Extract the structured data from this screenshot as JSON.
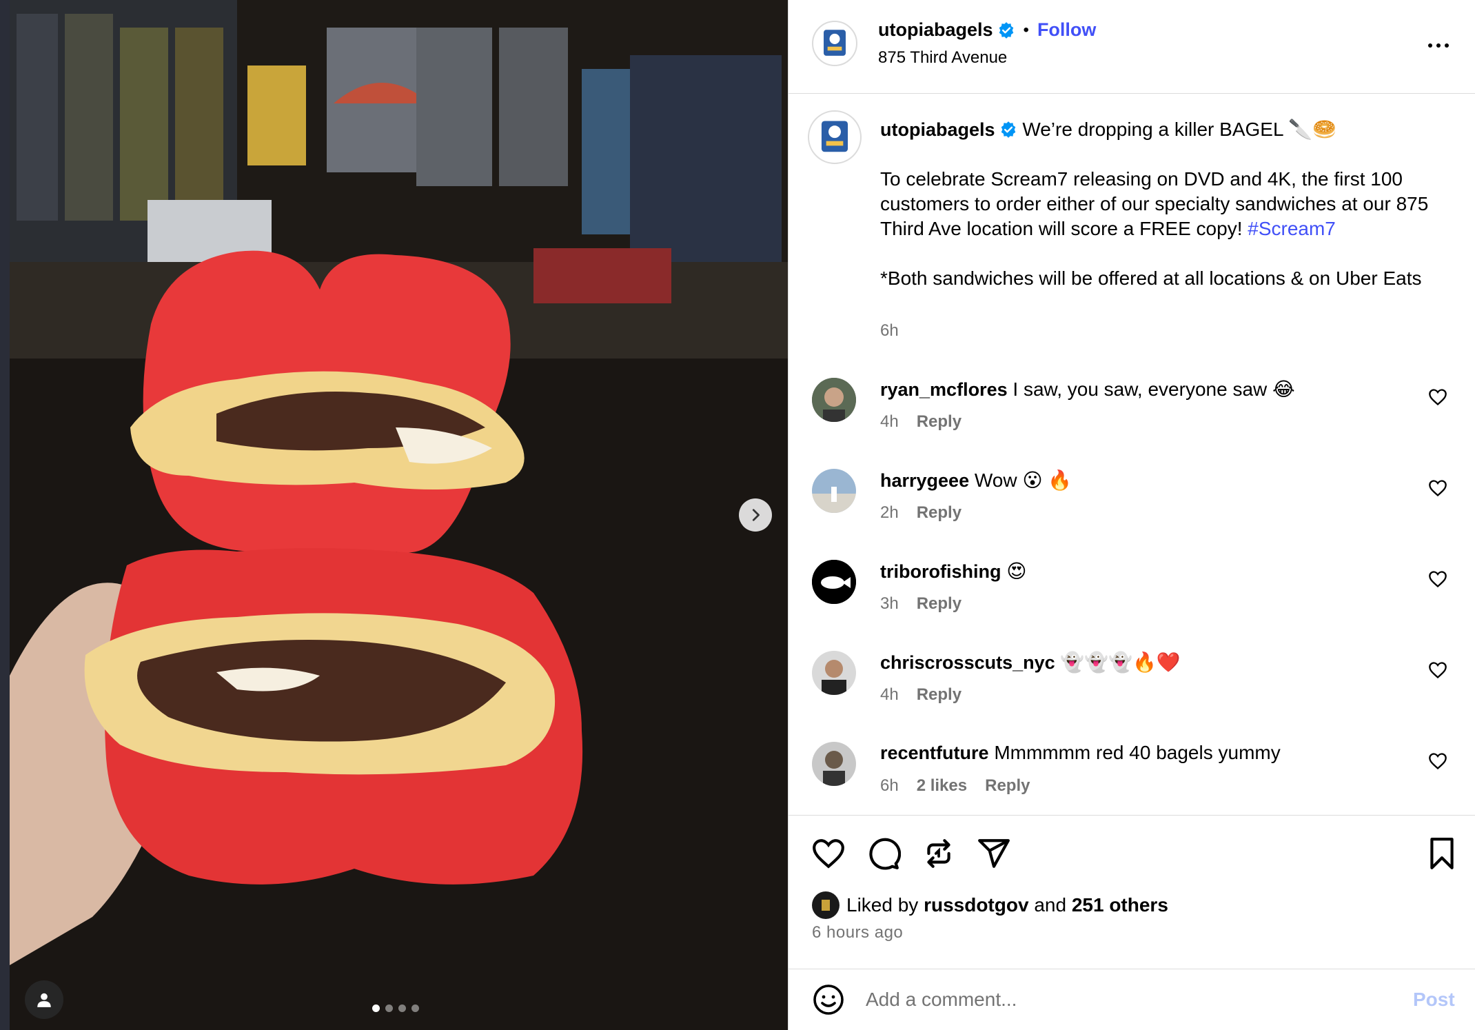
{
  "post": {
    "author": "utopiabagels",
    "follow_label": "Follow",
    "separator": "•",
    "location": "875 Third Avenue",
    "caption_line1": "We’re dropping a killer BAGEL 🔪🥯",
    "caption_p2_pre": "To celebrate Scream7 releasing on DVD and 4K, the first 100 customers to order either of our specialty sandwiches at our 875 Third Ave location will score a FREE copy! ",
    "caption_hashtag": "#Scream7",
    "caption_p3": "*Both sandwiches will be offered at all locations & on Uber Eats",
    "caption_time": "6h"
  },
  "comments": [
    {
      "user": "ryan_mcflores",
      "text": "I saw, you saw, everyone saw 😂",
      "time": "4h",
      "reply": "Reply"
    },
    {
      "user": "harrygeee",
      "text": "Wow 😮 🔥",
      "time": "2h",
      "reply": "Reply"
    },
    {
      "user": "triborofishing",
      "text": "😍",
      "time": "3h",
      "reply": "Reply"
    },
    {
      "user": "chriscrosscuts_nyc",
      "text": "👻👻👻🔥❤️",
      "time": "4h",
      "reply": "Reply"
    },
    {
      "user": "recentfuture",
      "text": "Mmmmmm red 40 bagels yummy",
      "time": "6h",
      "likes": "2 likes",
      "reply": "Reply"
    }
  ],
  "likes": {
    "prefix": "Liked by",
    "user": "russdotgov",
    "and": "and",
    "others": "251 others",
    "posted": "6 hours ago"
  },
  "add_comment": {
    "placeholder": "Add a comment...",
    "post_label": "Post"
  },
  "media": {
    "dots": 4,
    "active_dot": 1
  },
  "colors": {
    "accent_link": "#4150f7",
    "verified": "#0095f6",
    "meta_text": "#737373",
    "post_disabled": "#b3c6f9",
    "divider": "#dbdbdb"
  },
  "icons": [
    "chevron-right-icon",
    "user-tag-icon",
    "more-icon",
    "verified-icon",
    "heart-icon",
    "comment-icon",
    "repost-icon",
    "share-icon",
    "bookmark-icon",
    "emoji-icon"
  ]
}
